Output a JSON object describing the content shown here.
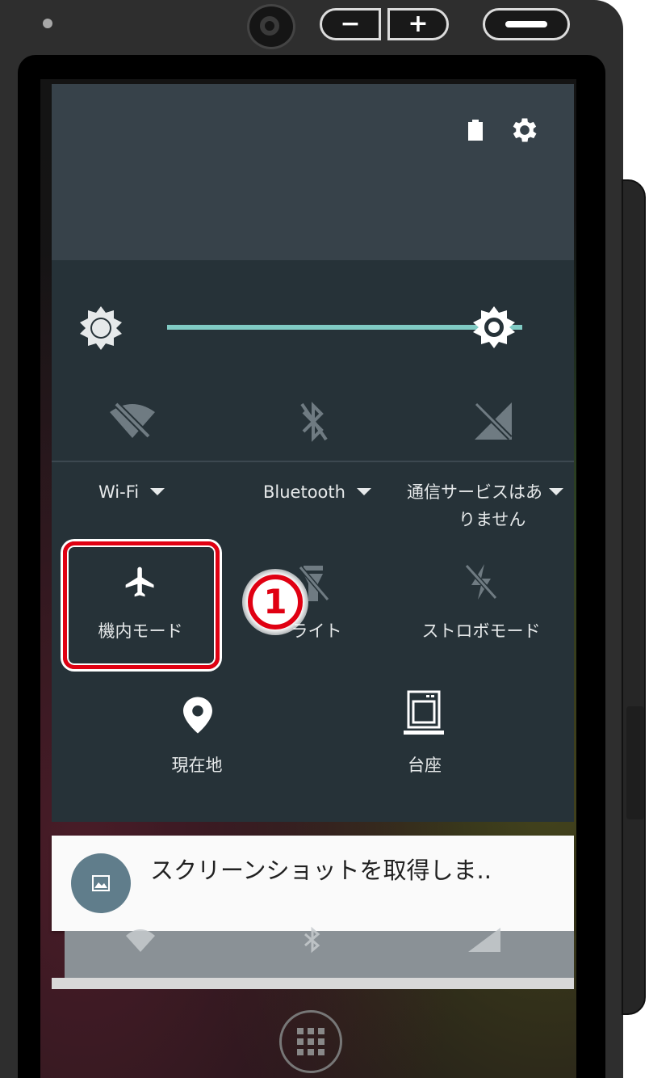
{
  "hardware": {
    "volume_down_label": "−",
    "volume_up_label": "+"
  },
  "brightness": {
    "level_percent": 100
  },
  "tiles_row1": [
    {
      "label": "Wi-Fi",
      "icon": "wifi-off-icon",
      "has_dropdown": true
    },
    {
      "label": "Bluetooth",
      "icon": "bluetooth-off-icon",
      "has_dropdown": true
    },
    {
      "label_line1": "通信サービスはあ",
      "label_line2": "りません",
      "icon": "no-sim-signal-icon",
      "has_dropdown": true
    }
  ],
  "tiles_row2": [
    {
      "label": "機内モード",
      "icon": "airplane-icon"
    },
    {
      "label": "ライト",
      "icon": "flashlight-off-icon"
    },
    {
      "label": "ストロボモード",
      "icon": "strobe-off-icon"
    }
  ],
  "tiles_row3": [
    {
      "label": "現在地",
      "icon": "location-icon"
    },
    {
      "label": "台座",
      "icon": "dock-icon"
    }
  ],
  "annotation": {
    "step_number": "1",
    "highlight_color": "#e00012"
  },
  "notification": {
    "title": "スクリーンショットを取得しま..",
    "icon": "image-icon"
  },
  "colors": {
    "shade_bg": "#263238",
    "header_bg": "#37424a",
    "slider_accent": "#80cbc4"
  }
}
